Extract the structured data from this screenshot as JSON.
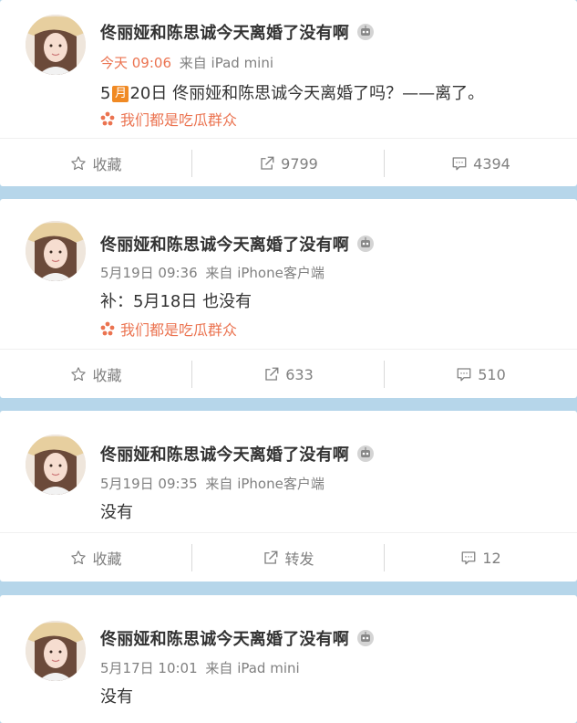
{
  "posts": [
    {
      "author": "佟丽娅和陈思诚今天离婚了没有啊",
      "time": "今天 09:06",
      "time_highlight": true,
      "source": "来自 iPad mini",
      "text_prefix": "5",
      "month_char": "月",
      "text_suffix": "20日  佟丽娅和陈思诚今天离婚了吗？——离了。",
      "topic": "我们都是吃瓜群众",
      "actions": {
        "collect": "收藏",
        "repost": "9799",
        "comment": "4394"
      }
    },
    {
      "author": "佟丽娅和陈思诚今天离婚了没有啊",
      "time": "5月19日 09:36",
      "time_highlight": false,
      "source": "来自 iPhone客户端",
      "text": "补：5月18日  也没有",
      "topic": "我们都是吃瓜群众",
      "actions": {
        "collect": "收藏",
        "repost": "633",
        "comment": "510"
      }
    },
    {
      "author": "佟丽娅和陈思诚今天离婚了没有啊",
      "time": "5月19日 09:35",
      "time_highlight": false,
      "source": "来自 iPhone客户端",
      "text": "没有",
      "actions": {
        "collect": "收藏",
        "repost": "转发",
        "comment": "12"
      }
    },
    {
      "author": "佟丽娅和陈思诚今天离婚了没有啊",
      "time": "5月17日 10:01",
      "time_highlight": false,
      "source": "来自 iPad mini",
      "text": "没有"
    }
  ],
  "colors": {
    "accent": "#eb7350",
    "month_badge": "#f08a24",
    "background": "#b6d6ea",
    "muted": "#808080"
  },
  "icons": {
    "collect": "star-outline-icon",
    "repost": "share-arrow-icon",
    "comment": "comment-bubble-icon",
    "topic": "flower-icon",
    "badge": "robot-badge-icon"
  }
}
